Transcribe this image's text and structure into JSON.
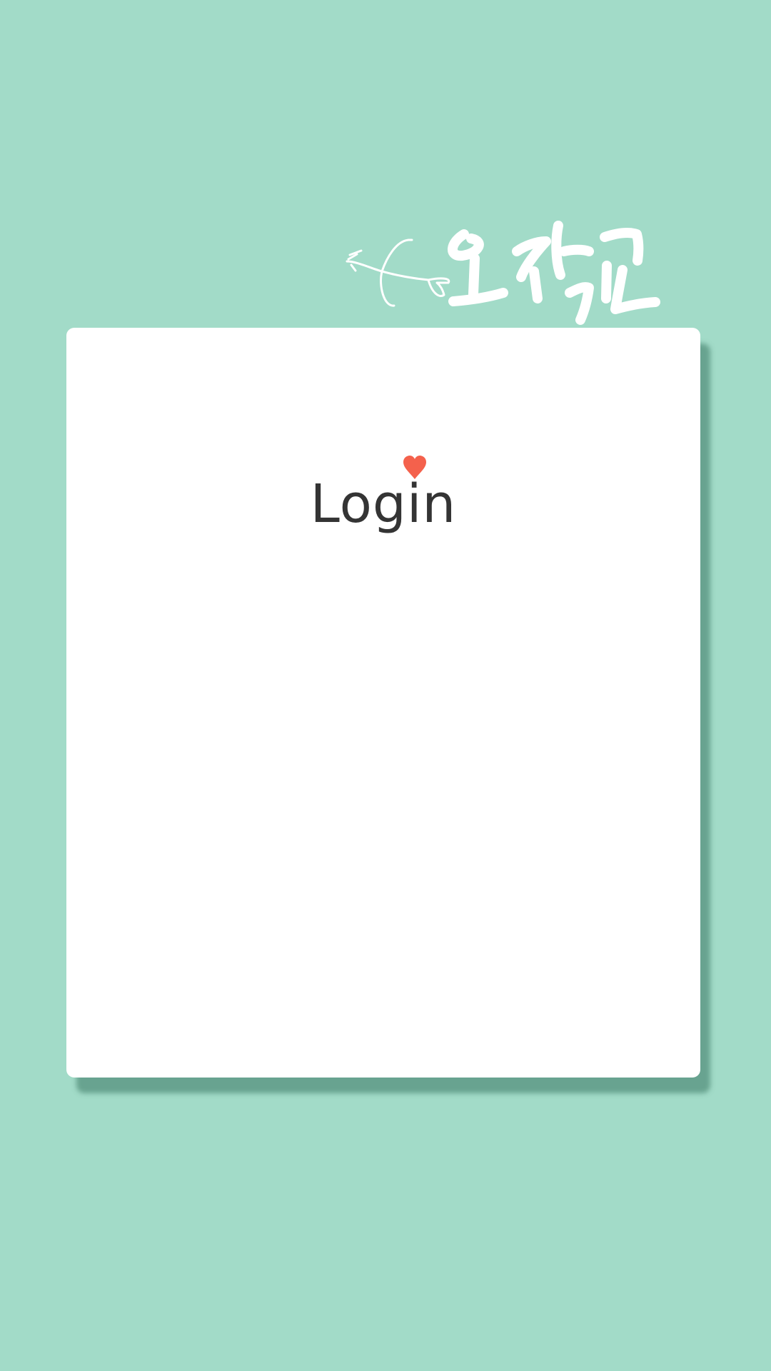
{
  "logo": {
    "text": "오작교",
    "icon": "cupid-arrow-icon",
    "color": "#ffffff"
  },
  "login_card": {
    "title_part1": "Log",
    "title_i": "i",
    "title_part2": "n",
    "heart_icon": "heart-icon",
    "heart_color": "#f4614c"
  },
  "colors": {
    "background": "#a2dbc8",
    "card": "#ffffff",
    "text": "#343434"
  }
}
